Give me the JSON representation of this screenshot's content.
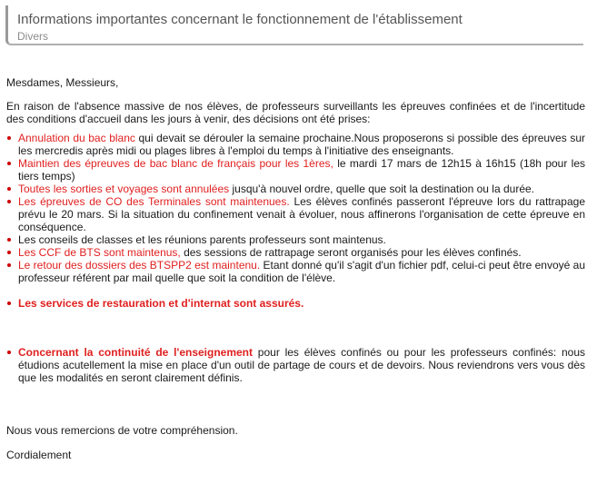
{
  "header": {
    "title": "Informations importantes concernant le fonctionnement de l'établissement",
    "subtitle": "Divers"
  },
  "body": {
    "greeting": "Mesdames, Messieurs,",
    "intro": "En raison de l'absence massive de nos élèves, de professeurs surveillants les épreuves confinées et de l'incertitude des conditions d'accueil dans les jours à venir, des décisions ont été prises:",
    "items": [
      {
        "highlight": "Annulation du bac blanc",
        "text": " qui devait se dérouler la semaine prochaine.Nous proposerons si possible des épreuves sur les mercredis après midi ou plages libres à l'emploi du temps à l'initiative des enseignants."
      },
      {
        "highlight": "Maintien des épreuves de bac blanc de français pour les 1ères,",
        "text": " le mardi 17 mars de 12h15 à 16h15 (18h pour les tiers temps)"
      },
      {
        "highlight": "Toutes les sorties et voyages sont annulées",
        "text": " jusqu'à nouvel ordre, quelle que soit la destination ou la durée."
      },
      {
        "highlight": "Les épreuves de CO des Terminales sont maintenues.",
        "text": " Les élèves confinés passeront l'épreuve lors du rattrapage prévu le 20 mars. Si la situation du confinement venait à évoluer, nous affinerons l'organisation de cette épreuve en conséquence."
      },
      {
        "highlight": "",
        "text": "Les conseils de classes et les réunions parents professeurs sont maintenus."
      },
      {
        "highlight": "Les CCF de BTS sont maintenus,",
        "text": " des sessions de rattrapage seront organisés pour les élèves confinés."
      },
      {
        "highlight": "Le retour des dossiers des BTSPP2 est maintenu.",
        "text": " Etant donné qu'il s'agit d'un fichier pdf, celui-ci peut être envoyé au professeur référent par mail quelle que soit la condition de l'élève."
      },
      {
        "highlight": "Les services de restauration et d'internat sont assurés.",
        "text": ""
      },
      {
        "highlight": "Concernant la continuité de l'enseignement",
        "text": " pour les élèves confinés ou pour les professeurs confinés: nous étudions acutellement la mise en place d'un outil de partage de cours et de devoirs. Nous reviendrons vers vous dès que les modalités en seront clairement définis."
      }
    ],
    "thanks": "Nous vous remercions de votre compréhension.",
    "closing": "Cordialement"
  }
}
